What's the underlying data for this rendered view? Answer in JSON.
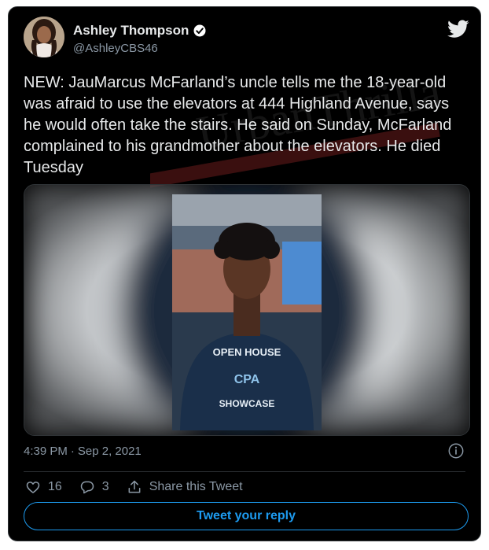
{
  "tweet": {
    "author_name": "Ashley Thompson",
    "author_handle": "@AshleyCBS46",
    "text": "NEW: JauMarcus McFarland’s uncle tells me the 18-year-old was afraid to use the elevators at 444 Highland Avenue, says he would often take the stairs. He said on Sunday, McFarland complained to his grandmother about the elevators. He died Tuesday",
    "time": "4:39 PM",
    "separator": "·",
    "date": "Sep 2, 2021",
    "likes": "16",
    "replies": "3",
    "share_label": "Share this Tweet",
    "reply_button_label": "Tweet your reply"
  },
  "photo": {
    "shirt_line1": "OPEN HOUSE",
    "shirt_line2": "CPA",
    "shirt_line3": "SHOWCASE"
  },
  "watermark": {
    "text": "UrbanThrilla"
  },
  "colors": {
    "background": "#000000",
    "text": "#e7e9ea",
    "secondary": "#8b98a5",
    "accent": "#1d9bf0",
    "verified_badge": "#ffffff"
  },
  "icons": [
    "verified-badge-icon",
    "twitter-bird-icon",
    "info-icon",
    "heart-icon",
    "reply-bubble-icon",
    "share-icon"
  ]
}
